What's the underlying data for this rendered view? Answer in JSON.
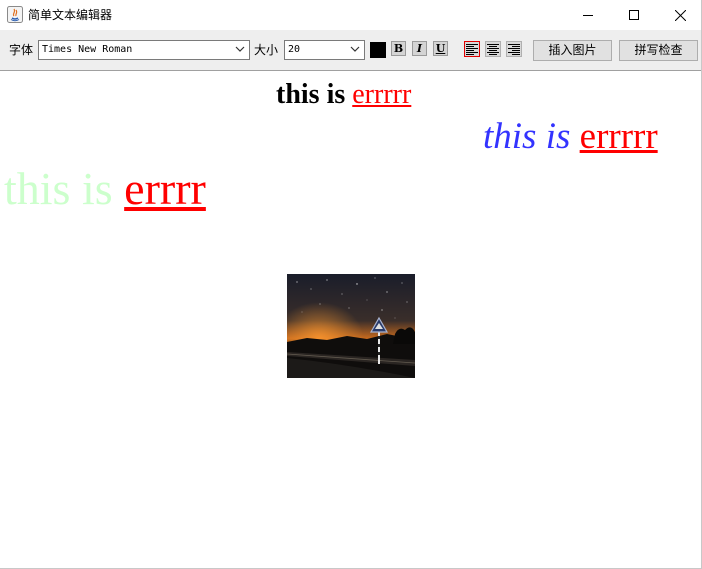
{
  "window": {
    "title": "简单文本编辑器"
  },
  "toolbar": {
    "font_label": "字体",
    "font_value": "Times New Roman",
    "size_label": "大小",
    "size_value": "20",
    "text_color": "#000000",
    "bold_label": "B",
    "italic_label": "I",
    "underline_label": "U",
    "insert_image_label": "插入图片",
    "spell_check_label": "拼写检查"
  },
  "document": {
    "line1": {
      "prefix": "this is ",
      "suffix": "errrrr",
      "prefix_color": "#000000",
      "suffix_color": "#ff0000",
      "align": "center"
    },
    "line2": {
      "prefix": "this is ",
      "suffix": "errrrr",
      "prefix_color": "#3333ff",
      "suffix_color": "#ff0000",
      "align": "right"
    },
    "line3": {
      "prefix": "this is ",
      "suffix": "errrr",
      "prefix_color": "#ccffcc",
      "suffix_color": "#ff0000",
      "align": "left"
    }
  }
}
